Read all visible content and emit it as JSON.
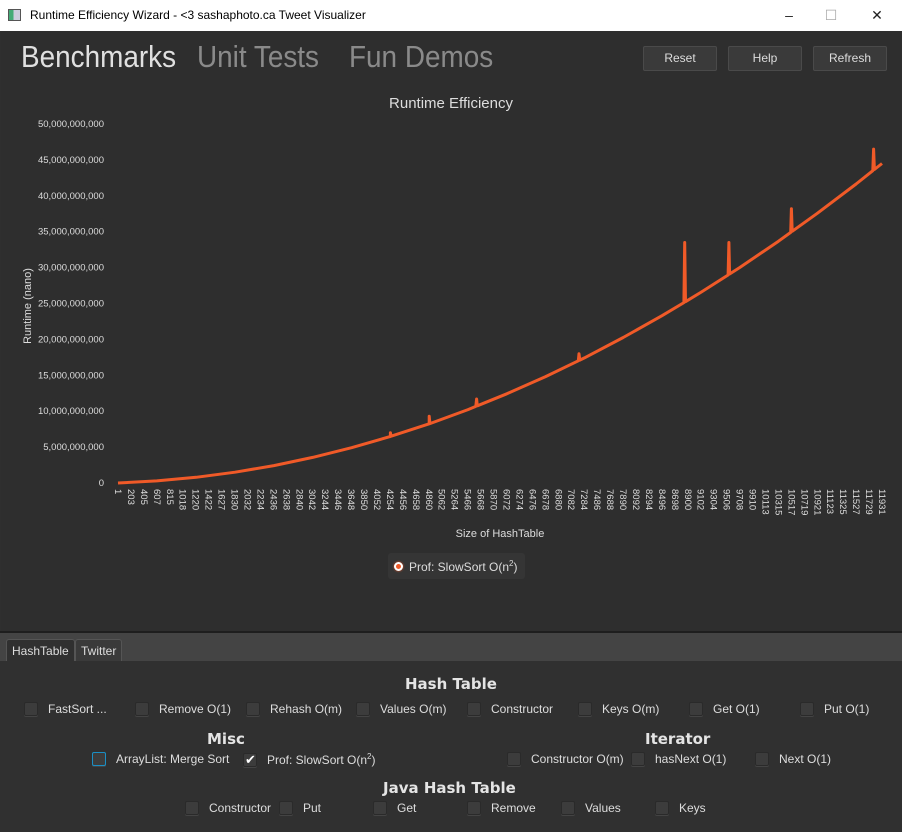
{
  "window": {
    "title": "Runtime Efficiency Wizard - <3 sashaphoto.ca Tweet Visualizer",
    "controls": [
      "minimize",
      "maximize",
      "close"
    ]
  },
  "nav": {
    "tabs": [
      {
        "label": "Benchmarks",
        "active": true
      },
      {
        "label": "Unit Tests",
        "active": false
      },
      {
        "label": "Fun Demos",
        "active": false
      }
    ]
  },
  "toolbar": {
    "reset": "Reset",
    "help": "Help",
    "refresh": "Refresh"
  },
  "chart_data": {
    "type": "line",
    "title": "Runtime Efficiency",
    "xlabel": "Size of HashTable",
    "ylabel": "Runtime (nano)",
    "ylim": [
      0,
      50000000000
    ],
    "yticks": [
      0,
      5000000000,
      10000000000,
      15000000000,
      20000000000,
      25000000000,
      30000000000,
      35000000000,
      40000000000,
      45000000000,
      50000000000
    ],
    "ytick_labels": [
      "0",
      "5,000,000,000",
      "10,000,000,000",
      "15,000,000,000",
      "20,000,000,000",
      "25,000,000,000",
      "30,000,000,000",
      "35,000,000,000",
      "40,000,000,000",
      "45,000,000,000",
      "50,000,000,000"
    ],
    "xtick_labels": [
      "1",
      "203",
      "405",
      "607",
      "815",
      "1018",
      "1220",
      "1422",
      "1627",
      "1830",
      "2032",
      "2234",
      "2436",
      "2638",
      "2840",
      "3042",
      "3244",
      "3446",
      "3648",
      "3850",
      "4052",
      "4254",
      "4456",
      "4658",
      "4860",
      "5062",
      "5264",
      "5466",
      "5668",
      "5870",
      "6072",
      "6274",
      "6476",
      "6678",
      "6880",
      "7082",
      "7284",
      "7486",
      "7688",
      "7890",
      "8092",
      "8294",
      "8496",
      "8698",
      "8900",
      "9102",
      "9304",
      "9506",
      "9708",
      "9910",
      "10113",
      "10315",
      "10517",
      "10719",
      "10921",
      "11123",
      "11325",
      "11527",
      "11729",
      "11931"
    ],
    "grid": false,
    "legend_placement": "bottom",
    "color": "#f05a28",
    "series": [
      {
        "name": "Prof: SlowSort O(n²)",
        "x": [
          1,
          607,
          1220,
          1830,
          2436,
          3042,
          3648,
          4254,
          4860,
          5466,
          6072,
          6678,
          7284,
          7890,
          8496,
          9102,
          9708,
          10315,
          10921,
          11527,
          11931
        ],
        "y": [
          0,
          290000000,
          790000000,
          1510000000,
          2430000000,
          3570000000,
          4920000000,
          6480000000,
          8240000000,
          10220000000,
          12420000000,
          14820000000,
          17430000000,
          20260000000,
          23300000000,
          26540000000,
          30000000000,
          33680000000,
          37560000000,
          41650000000,
          44500000000
        ],
        "spikes": [
          {
            "x": 4254,
            "y": 7000000000
          },
          {
            "x": 4860,
            "y": 9300000000
          },
          {
            "x": 5600,
            "y": 11700000000
          },
          {
            "x": 7200,
            "y": 18000000000
          },
          {
            "x": 8850,
            "y": 33500000000
          },
          {
            "x": 9540,
            "y": 33500000000
          },
          {
            "x": 10517,
            "y": 38200000000
          },
          {
            "x": 11800,
            "y": 46500000000
          }
        ]
      }
    ]
  },
  "legend": {
    "label": "Prof: SlowSort O(n",
    "sup": "2",
    ")": ")"
  },
  "bottom_tabs": [
    {
      "label": "HashTable",
      "active": true
    },
    {
      "label": "Twitter",
      "active": false
    }
  ],
  "sections": {
    "hash_table": {
      "title": "Hash Table",
      "items": [
        {
          "label": "FastSort ...",
          "checked": false
        },
        {
          "label": "Remove O(1)",
          "checked": false
        },
        {
          "label": "Rehash O(m)",
          "checked": false
        },
        {
          "label": "Values O(m)",
          "checked": false
        },
        {
          "label": "Constructor",
          "checked": false
        },
        {
          "label": "Keys O(m)",
          "checked": false
        },
        {
          "label": "Get O(1)",
          "checked": false
        },
        {
          "label": "Put O(1)",
          "checked": false
        }
      ]
    },
    "misc": {
      "title": "Misc",
      "items": [
        {
          "label": "ArrayList: Merge Sort",
          "checked": false,
          "focused": true
        },
        {
          "label": "Prof: SlowSort O(n",
          "sup": "2",
          "tail": ")",
          "checked": true
        }
      ]
    },
    "iterator": {
      "title": "Iterator",
      "items": [
        {
          "label": "Constructor O(m)",
          "checked": false
        },
        {
          "label": "hasNext O(1)",
          "checked": false
        },
        {
          "label": "Next O(1)",
          "checked": false
        }
      ]
    },
    "java_hash_table": {
      "title": "Java Hash Table",
      "items": [
        {
          "label": "Constructor",
          "checked": false
        },
        {
          "label": "Put",
          "checked": false
        },
        {
          "label": "Get",
          "checked": false
        },
        {
          "label": "Remove",
          "checked": false
        },
        {
          "label": "Values",
          "checked": false
        },
        {
          "label": "Keys",
          "checked": false
        }
      ]
    }
  }
}
